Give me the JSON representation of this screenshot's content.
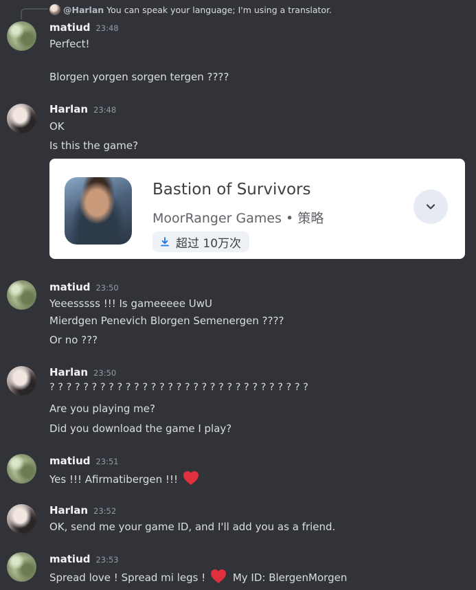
{
  "reply": {
    "author": "@Harlan",
    "text": "You can speak your language; I'm using a translator."
  },
  "messages": [
    {
      "author": "matiud",
      "time": "23:48",
      "lines": [
        "Perfect!",
        "Blorgen yorgen sorgen tergen ????"
      ]
    },
    {
      "author": "Harlan",
      "time": "23:48",
      "lines": [
        "OK",
        "Is this the game?"
      ]
    },
    {
      "author": "matiud",
      "time": "23:50",
      "lines": [
        "Yeeesssss !!! Is gameeeee UwU",
        "Mierdgen Penevich Blorgen Semenergen ????",
        "Or no ???"
      ]
    },
    {
      "author": "Harlan",
      "time": "23:50",
      "lines": [
        "? ? ? ? ? ? ? ? ? ? ? ? ? ? ? ? ? ? ? ? ? ? ? ? ? ? ? ? ? ? ?",
        "Are you playing me?",
        "Did you download the game I play?"
      ]
    },
    {
      "author": "matiud",
      "time": "23:51",
      "lines": [
        "Yes !!! Afirmatibergen !!!"
      ]
    },
    {
      "author": "Harlan",
      "time": "23:52",
      "lines": [
        "OK, send me your game ID, and I'll add you as a friend."
      ]
    },
    {
      "author": "matiud",
      "time": "23:53",
      "lines": [
        "Spread love ! Spread mi legs !",
        "My ID: BlergenMorgen"
      ]
    }
  ],
  "embed": {
    "app_name": "Bastion of Survivors",
    "developer": "MoorRanger Games",
    "separator": "•",
    "category": "策略",
    "downloads": "超过 10万次",
    "download_icon": "download-icon",
    "expand_icon": "chevron-down-icon"
  },
  "colors": {
    "background": "#313338",
    "text": "#dbdee1",
    "timestamp": "#949ba4",
    "heart": "#e0303e"
  }
}
